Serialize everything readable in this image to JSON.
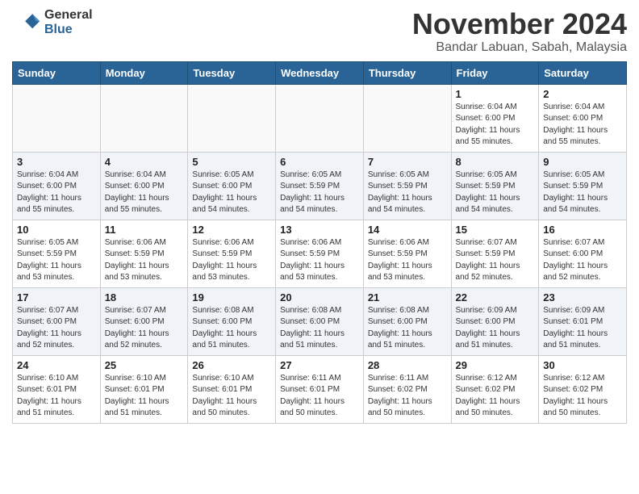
{
  "header": {
    "logo_general": "General",
    "logo_blue": "Blue",
    "month_title": "November 2024",
    "location": "Bandar Labuan, Sabah, Malaysia"
  },
  "calendar": {
    "days_of_week": [
      "Sunday",
      "Monday",
      "Tuesday",
      "Wednesday",
      "Thursday",
      "Friday",
      "Saturday"
    ],
    "weeks": [
      [
        {
          "day": "",
          "info": ""
        },
        {
          "day": "",
          "info": ""
        },
        {
          "day": "",
          "info": ""
        },
        {
          "day": "",
          "info": ""
        },
        {
          "day": "",
          "info": ""
        },
        {
          "day": "1",
          "info": "Sunrise: 6:04 AM\nSunset: 6:00 PM\nDaylight: 11 hours and 55 minutes."
        },
        {
          "day": "2",
          "info": "Sunrise: 6:04 AM\nSunset: 6:00 PM\nDaylight: 11 hours and 55 minutes."
        }
      ],
      [
        {
          "day": "3",
          "info": "Sunrise: 6:04 AM\nSunset: 6:00 PM\nDaylight: 11 hours and 55 minutes."
        },
        {
          "day": "4",
          "info": "Sunrise: 6:04 AM\nSunset: 6:00 PM\nDaylight: 11 hours and 55 minutes."
        },
        {
          "day": "5",
          "info": "Sunrise: 6:05 AM\nSunset: 6:00 PM\nDaylight: 11 hours and 54 minutes."
        },
        {
          "day": "6",
          "info": "Sunrise: 6:05 AM\nSunset: 5:59 PM\nDaylight: 11 hours and 54 minutes."
        },
        {
          "day": "7",
          "info": "Sunrise: 6:05 AM\nSunset: 5:59 PM\nDaylight: 11 hours and 54 minutes."
        },
        {
          "day": "8",
          "info": "Sunrise: 6:05 AM\nSunset: 5:59 PM\nDaylight: 11 hours and 54 minutes."
        },
        {
          "day": "9",
          "info": "Sunrise: 6:05 AM\nSunset: 5:59 PM\nDaylight: 11 hours and 54 minutes."
        }
      ],
      [
        {
          "day": "10",
          "info": "Sunrise: 6:05 AM\nSunset: 5:59 PM\nDaylight: 11 hours and 53 minutes."
        },
        {
          "day": "11",
          "info": "Sunrise: 6:06 AM\nSunset: 5:59 PM\nDaylight: 11 hours and 53 minutes."
        },
        {
          "day": "12",
          "info": "Sunrise: 6:06 AM\nSunset: 5:59 PM\nDaylight: 11 hours and 53 minutes."
        },
        {
          "day": "13",
          "info": "Sunrise: 6:06 AM\nSunset: 5:59 PM\nDaylight: 11 hours and 53 minutes."
        },
        {
          "day": "14",
          "info": "Sunrise: 6:06 AM\nSunset: 5:59 PM\nDaylight: 11 hours and 53 minutes."
        },
        {
          "day": "15",
          "info": "Sunrise: 6:07 AM\nSunset: 5:59 PM\nDaylight: 11 hours and 52 minutes."
        },
        {
          "day": "16",
          "info": "Sunrise: 6:07 AM\nSunset: 6:00 PM\nDaylight: 11 hours and 52 minutes."
        }
      ],
      [
        {
          "day": "17",
          "info": "Sunrise: 6:07 AM\nSunset: 6:00 PM\nDaylight: 11 hours and 52 minutes."
        },
        {
          "day": "18",
          "info": "Sunrise: 6:07 AM\nSunset: 6:00 PM\nDaylight: 11 hours and 52 minutes."
        },
        {
          "day": "19",
          "info": "Sunrise: 6:08 AM\nSunset: 6:00 PM\nDaylight: 11 hours and 51 minutes."
        },
        {
          "day": "20",
          "info": "Sunrise: 6:08 AM\nSunset: 6:00 PM\nDaylight: 11 hours and 51 minutes."
        },
        {
          "day": "21",
          "info": "Sunrise: 6:08 AM\nSunset: 6:00 PM\nDaylight: 11 hours and 51 minutes."
        },
        {
          "day": "22",
          "info": "Sunrise: 6:09 AM\nSunset: 6:00 PM\nDaylight: 11 hours and 51 minutes."
        },
        {
          "day": "23",
          "info": "Sunrise: 6:09 AM\nSunset: 6:01 PM\nDaylight: 11 hours and 51 minutes."
        }
      ],
      [
        {
          "day": "24",
          "info": "Sunrise: 6:10 AM\nSunset: 6:01 PM\nDaylight: 11 hours and 51 minutes."
        },
        {
          "day": "25",
          "info": "Sunrise: 6:10 AM\nSunset: 6:01 PM\nDaylight: 11 hours and 51 minutes."
        },
        {
          "day": "26",
          "info": "Sunrise: 6:10 AM\nSunset: 6:01 PM\nDaylight: 11 hours and 50 minutes."
        },
        {
          "day": "27",
          "info": "Sunrise: 6:11 AM\nSunset: 6:01 PM\nDaylight: 11 hours and 50 minutes."
        },
        {
          "day": "28",
          "info": "Sunrise: 6:11 AM\nSunset: 6:02 PM\nDaylight: 11 hours and 50 minutes."
        },
        {
          "day": "29",
          "info": "Sunrise: 6:12 AM\nSunset: 6:02 PM\nDaylight: 11 hours and 50 minutes."
        },
        {
          "day": "30",
          "info": "Sunrise: 6:12 AM\nSunset: 6:02 PM\nDaylight: 11 hours and 50 minutes."
        }
      ]
    ]
  }
}
